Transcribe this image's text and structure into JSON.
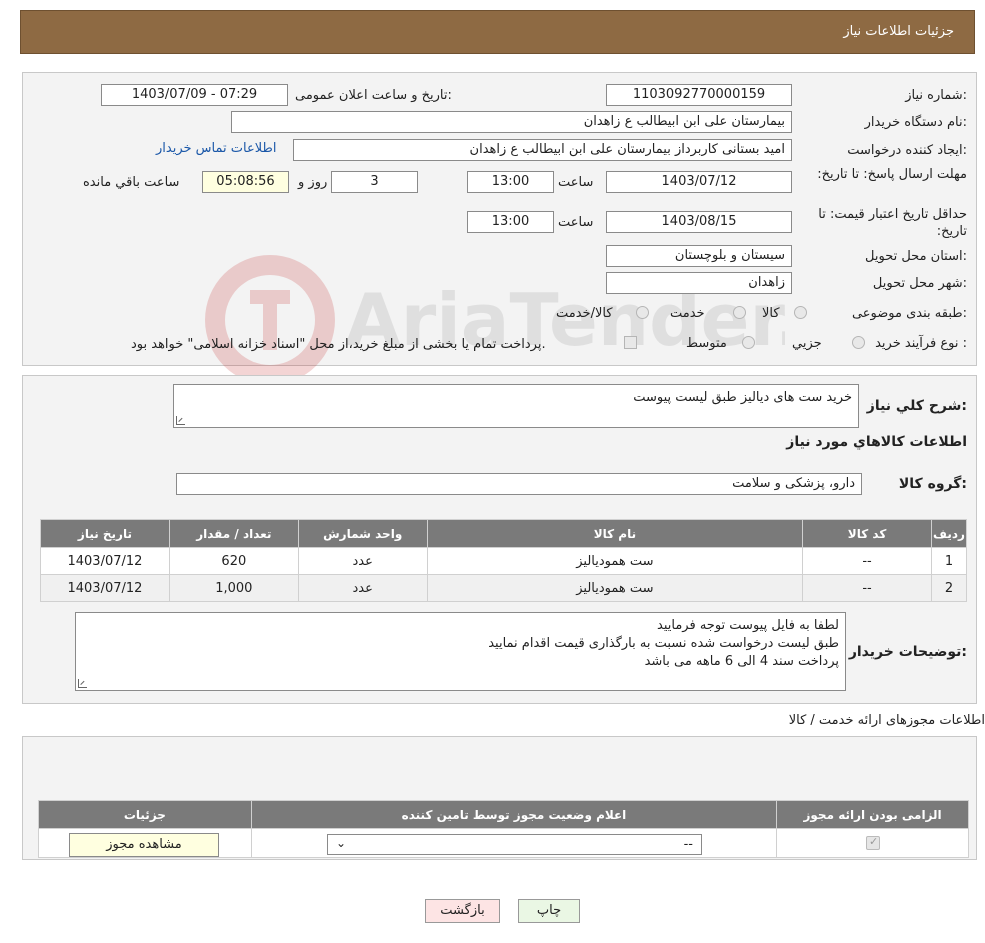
{
  "header": {
    "title": "جزئیات اطلاعات نیاز"
  },
  "form": {
    "need_number_label": "شماره نیاز:",
    "need_number": "1103092770000159",
    "announce_label": "تاریخ و ساعت اعلان عمومی:",
    "announce_value": "1403/07/09 - 07:29",
    "buyer_org_label": "نام دستگاه خریدار:",
    "buyer_org": "بیمارستان علی ابن ابیطالب  ع  زاهدان",
    "creator_label": "ایجاد کننده درخواست:",
    "creator": "امید بستانی کاربرداز  بیمارستان علی ابن ابیطالب  ع  زاهدان",
    "contact_link": "اطلاعات تماس خریدار",
    "deadline_label": "مهلت ارسال پاسخ: تا تاریخ:",
    "deadline_date": "1403/07/12",
    "time_label": "ساعت",
    "deadline_time": "13:00",
    "days_value": "3",
    "days_label": "روز و",
    "remaining_time": "05:08:56",
    "remaining_label": "ساعت باقي مانده",
    "validity_label": "حداقل تاریخ اعتبار قیمت: تا تاریخ:",
    "validity_date": "1403/08/15",
    "validity_time": "13:00",
    "province_label": "استان محل تحویل:",
    "province": "سیستان و بلوچستان",
    "city_label": "شهر محل تحویل:",
    "city": "زاهدان",
    "category_label": "طبقه بندی موضوعی:",
    "category_options": [
      "کالا",
      "خدمت",
      "کالا/خدمت"
    ],
    "process_label": "نوع فرآیند خرید :",
    "process_options": [
      "جزیي",
      "متوسط"
    ],
    "process_note": "پرداخت تمام یا بخشی از مبلغ خرید،از محل \"اسناد خزانه اسلامی\" خواهد بود."
  },
  "description": {
    "label": "شرح کلي نياز:",
    "value": "خرید ست های دیالیز طبق لیست پیوست",
    "goods_info_title": "اطلاعات کالاهاي مورد نياز",
    "group_label": "گروه کالا:",
    "group_value": "دارو، پزشکی و سلامت"
  },
  "goods_table": {
    "headers": [
      "رديف",
      "کد کالا",
      "نام کالا",
      "واحد شمارش",
      "تعداد / مقدار",
      "تاریخ نیاز"
    ],
    "rows": [
      [
        "1",
        "--",
        "ست همودیالیز",
        "عدد",
        "620",
        "1403/07/12"
      ],
      [
        "2",
        "--",
        "ست همودیالیز",
        "عدد",
        "1,000",
        "1403/07/12"
      ]
    ]
  },
  "buyer_notes": {
    "label": "توضیحات خریدار:",
    "lines": [
      "لطفا به فایل پیوست توجه فرمایید",
      "طبق لیست درخواست شده نسبت به بارگذاری قیمت اقدام نمایید",
      "پرداخت سند 4 الی 6 ماهه می باشد"
    ]
  },
  "permits": {
    "title": "اطلاعات مجوزهای ارائه خدمت / کالا",
    "headers": [
      "الزامی بودن ارائه مجوز",
      "اعلام وضعیت مجوز توسط تامین کننده",
      "جزئیات"
    ],
    "select_value": "--",
    "view_button": "مشاهده مجوز"
  },
  "buttons": {
    "print": "چاپ",
    "back": "بازگشت"
  },
  "watermark": {
    "text": "AriaTender.neT"
  }
}
